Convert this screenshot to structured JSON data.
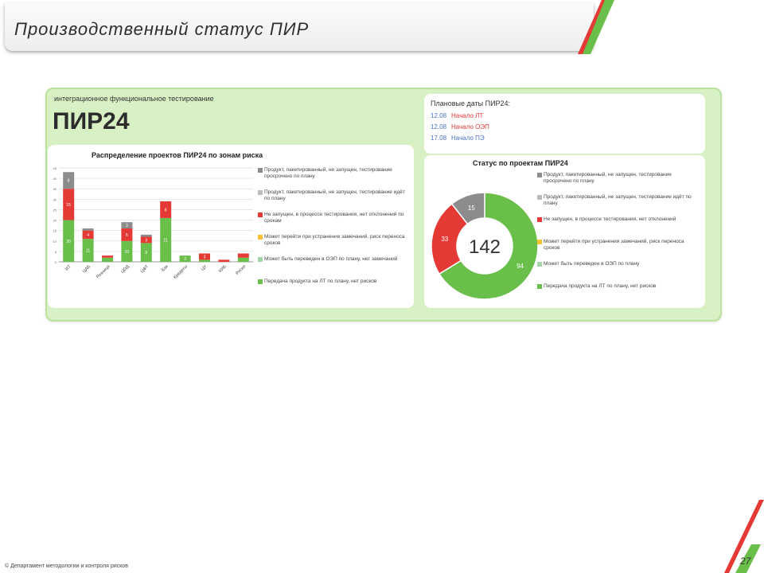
{
  "header": {
    "title": "Производственный статус ПИР"
  },
  "panel": {
    "subtitle": "интеграционное функциональное тестирование",
    "title": "ПИР24"
  },
  "dates": {
    "heading": "Плановые даты ПИР24:",
    "rows": [
      {
        "value": "12.08",
        "label": "Начало ЛТ",
        "color": "#e53935"
      },
      {
        "value": "12.08",
        "label": "Начало ОЭП",
        "color": "#e53935"
      },
      {
        "value": "17.08",
        "label": "Начало ПЭ",
        "color": "#4a72c4"
      }
    ]
  },
  "bar_card": {
    "title": "Распределение проектов ПИР24 по зонам риска",
    "legend": [
      {
        "label": "Продукт, пакетированный, не запущен, тестирование просрочено по плану",
        "color": "#8c8c8c"
      },
      {
        "label": "Продукт, пакетированный, не запущен, тестирование идёт по плану",
        "color": "#bdbdbd"
      },
      {
        "label": "Не запущен, в процессе тестирования, нет отклонений по срокам",
        "color": "#e53935"
      },
      {
        "label": "Может перейти при устранении замечаний, риск переноса сроков",
        "color": "#fbc02d"
      },
      {
        "label": "Может быть переведен в ОЭП по плану, нет замечаний",
        "color": "#a5d6a7"
      },
      {
        "label": "Передача продукта на ЛТ по плану, нет рисков",
        "color": "#6abf4b"
      }
    ]
  },
  "donut_card": {
    "title": "Статус по проектам ПИР24",
    "legend": [
      {
        "label": "Продукт, пакетированный, не запущен, тестирование просрочено по плану",
        "color": "#8c8c8c"
      },
      {
        "label": "Продукт, пакетированный, не запущен, тестирование идёт по плану",
        "color": "#bdbdbd"
      },
      {
        "label": "Не запущен, в процессе тестирования, нет отклонений",
        "color": "#e53935"
      },
      {
        "label": "Может перейти при устранении замечаний, риск переноса сроков",
        "color": "#fbc02d"
      },
      {
        "label": "Может быть переведен в ОЭП по плану",
        "color": "#a5d6a7"
      },
      {
        "label": "Передача продукта на ЛТ по плану, нет рисков",
        "color": "#6abf4b"
      }
    ]
  },
  "chart_data": [
    {
      "type": "bar",
      "title": "Распределение проектов ПИР24 по зонам риска",
      "categories": [
        "ИТ",
        "ЦАБ",
        "Розница",
        "ЦОД",
        "ЦФТ",
        "Бэк",
        "Кредиты",
        "ЦУ",
        "КИБ",
        "Риски"
      ],
      "series": [
        {
          "name": "green",
          "color": "#6abf4b",
          "values": [
            20,
            11,
            2,
            10,
            9,
            21,
            3,
            1,
            0,
            2
          ]
        },
        {
          "name": "red",
          "color": "#e53935",
          "values": [
            15,
            4,
            1,
            6,
            3,
            8,
            0,
            3,
            1,
            2
          ]
        },
        {
          "name": "gray",
          "color": "#8c8c8c",
          "values": [
            8,
            1,
            0,
            3,
            1,
            0,
            0,
            0,
            0,
            0
          ]
        }
      ],
      "ylim": [
        0,
        45
      ]
    },
    {
      "type": "pie",
      "title": "Статус по проектам ПИР24",
      "center_label": "142",
      "slices": [
        {
          "value": 94,
          "color": "#6abf4b",
          "label": "94"
        },
        {
          "value": 33,
          "color": "#e53935",
          "label": "33"
        },
        {
          "value": 15,
          "color": "#8c8c8c",
          "label": "15"
        }
      ]
    }
  ],
  "footer": {
    "text": "© Департамент методологии и контроля рисков"
  },
  "page": {
    "number": "27"
  },
  "colors": {
    "accent_green": "#6abf4b",
    "accent_red": "#e53935"
  }
}
